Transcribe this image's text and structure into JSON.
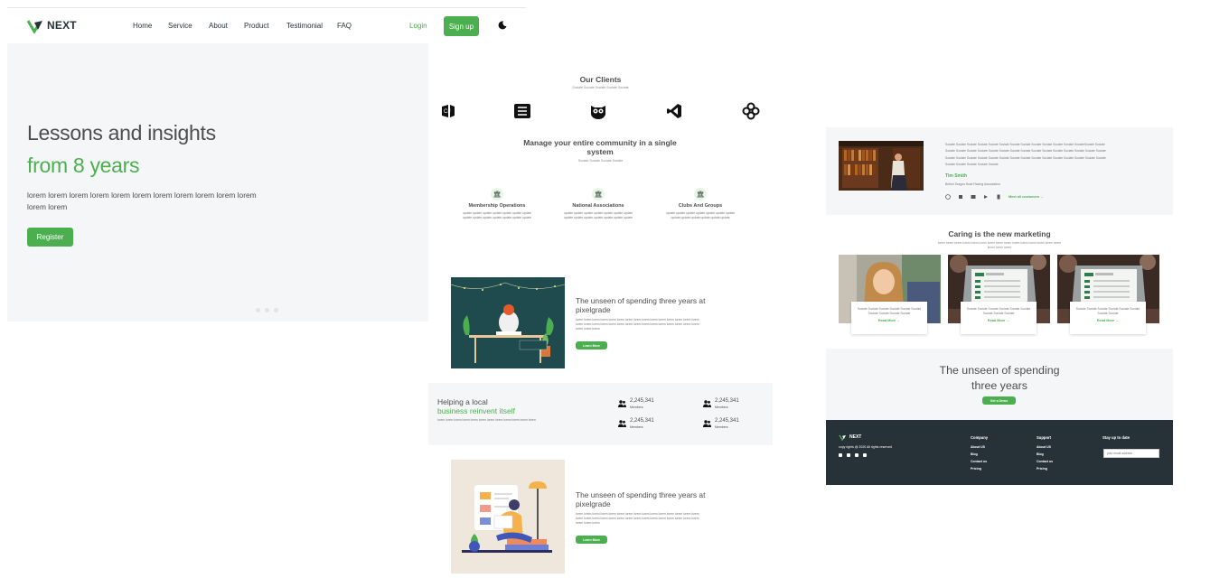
{
  "nav": {
    "logo": "NEXT",
    "links": [
      "Home",
      "Service",
      "About",
      "Product",
      "Testimonial",
      "FAQ"
    ],
    "login": "Login",
    "signup": "Sign up",
    "moon_icon": "moon-icon"
  },
  "hero": {
    "title_line1": "Lessons and insights",
    "title_line2": "from 8 years",
    "text": "lorem lorem lorem lorem lorem lorem lorem lorem lorem lorem lorem lorem lorem",
    "button": "Register",
    "slides": 3
  },
  "clients": {
    "title": "Our Clients",
    "subtitle": "Sociate Sociate Sociate Sociate Sociate"
  },
  "community": {
    "title": "Manage your entire community in a single system",
    "subtitle": "Sociate Sociate Sociate Sociate",
    "features": [
      {
        "title": "Membership Operations",
        "text": "update update update update update update update update update update update update update update"
      },
      {
        "title": "National Associations",
        "text": "update update update update update update update update update update update update update update"
      },
      {
        "title": "Clubs And Groups",
        "text": "update update update update update update update update update update update update update"
      }
    ]
  },
  "section1": {
    "title": "The unseen of spending three years at pixelgrade",
    "text": "lorem lorem lorem lorem lorem lorem lorem lorem lorem lorem lorem lorem lorem lorem lorem lorem lorem lorem lorem lorem lorem lorem lorem lorem lorem lorem lorem lorem lorem lorem lorem lorem lorem",
    "button": "Learn More"
  },
  "stats": {
    "title_line1": "Helping a local",
    "title_line2": "business reinvent itself",
    "text": "lorem lorem lorem lorem lorem lorem lorem lorem lorem lorem lorem lorem",
    "items": [
      {
        "number": "2,245,341",
        "label": "Members"
      },
      {
        "number": "2,245,341",
        "label": "Members"
      },
      {
        "number": "2,245,341",
        "label": "Members"
      },
      {
        "number": "2,245,341",
        "label": "Members"
      }
    ]
  },
  "section2": {
    "title": "The unseen of spending three years at pixelgrade",
    "text": "lorem lorem lorem lorem lorem lorem lorem lorem lorem lorem lorem lorem lorem lorem lorem lorem lorem lorem lorem lorem lorem lorem lorem lorem lorem lorem lorem lorem lorem lorem lorem lorem lorem",
    "button": "Learn More"
  },
  "testimonial": {
    "text": "Sociate Sociate Sociate Sociate Sociate Sociate Sociate Sociate Sociate Sociate Sociate Sociate SociateSociate Sociate Sociate Sociate Sociate Sociate Sociate Sociate Sociate Sociate Sociate Sociate Sociate Sociate Sociate Sociate Sociate Sociate Sociate Sociate Sociate Sociate Sociate Sociate Sociate Sociate Sociate Sociate Sociate Sociate Sociate Sociate Sociate Sociate Sociate Sociate Sociate",
    "name": "Tim Smith",
    "role": "British Dragon Boat Racing Association",
    "link": "Meet all customers →"
  },
  "caring": {
    "title": "Caring is the new marketing",
    "subtitle": "lorem lorem lorem lorem lorem lorem lorem lorem lorem lorem lorem lorem lorem lorem lorem lorem lorem lorem",
    "cards": [
      {
        "text": "Sociate Sociate Sociate Sociate Sociate Sociate Sociate Sociate Sociate Sociate",
        "more": "Read More →"
      },
      {
        "text": "Sociate Sociate Sociate Sociate Sociate Sociate Sociate Sociate Sociate",
        "more": "Read More →"
      },
      {
        "text": "Sociate Sociate Sociate Sociate Sociate Sociate Sociate Sociate",
        "more": "Read More →"
      }
    ]
  },
  "cta": {
    "title_line1": "The unseen of spending",
    "title_line2": "three years",
    "button": "Get a Demo"
  },
  "footer": {
    "logo": "NEXT",
    "copyright": "copy rights @ 2020 All rights reserved",
    "company_title": "Company",
    "company_links": [
      "About US",
      "Blog",
      "Contact us",
      "Pricing"
    ],
    "support_title": "Support",
    "support_links": [
      "About US",
      "Blog",
      "Contact us",
      "Pricing"
    ],
    "stay_title": "Stay up to date",
    "email_placeholder": "your email address"
  },
  "colors": {
    "accent": "#4caf4f",
    "dark": "#263238",
    "light_bg": "#f5f6f8",
    "text": "#4d4d4d"
  }
}
